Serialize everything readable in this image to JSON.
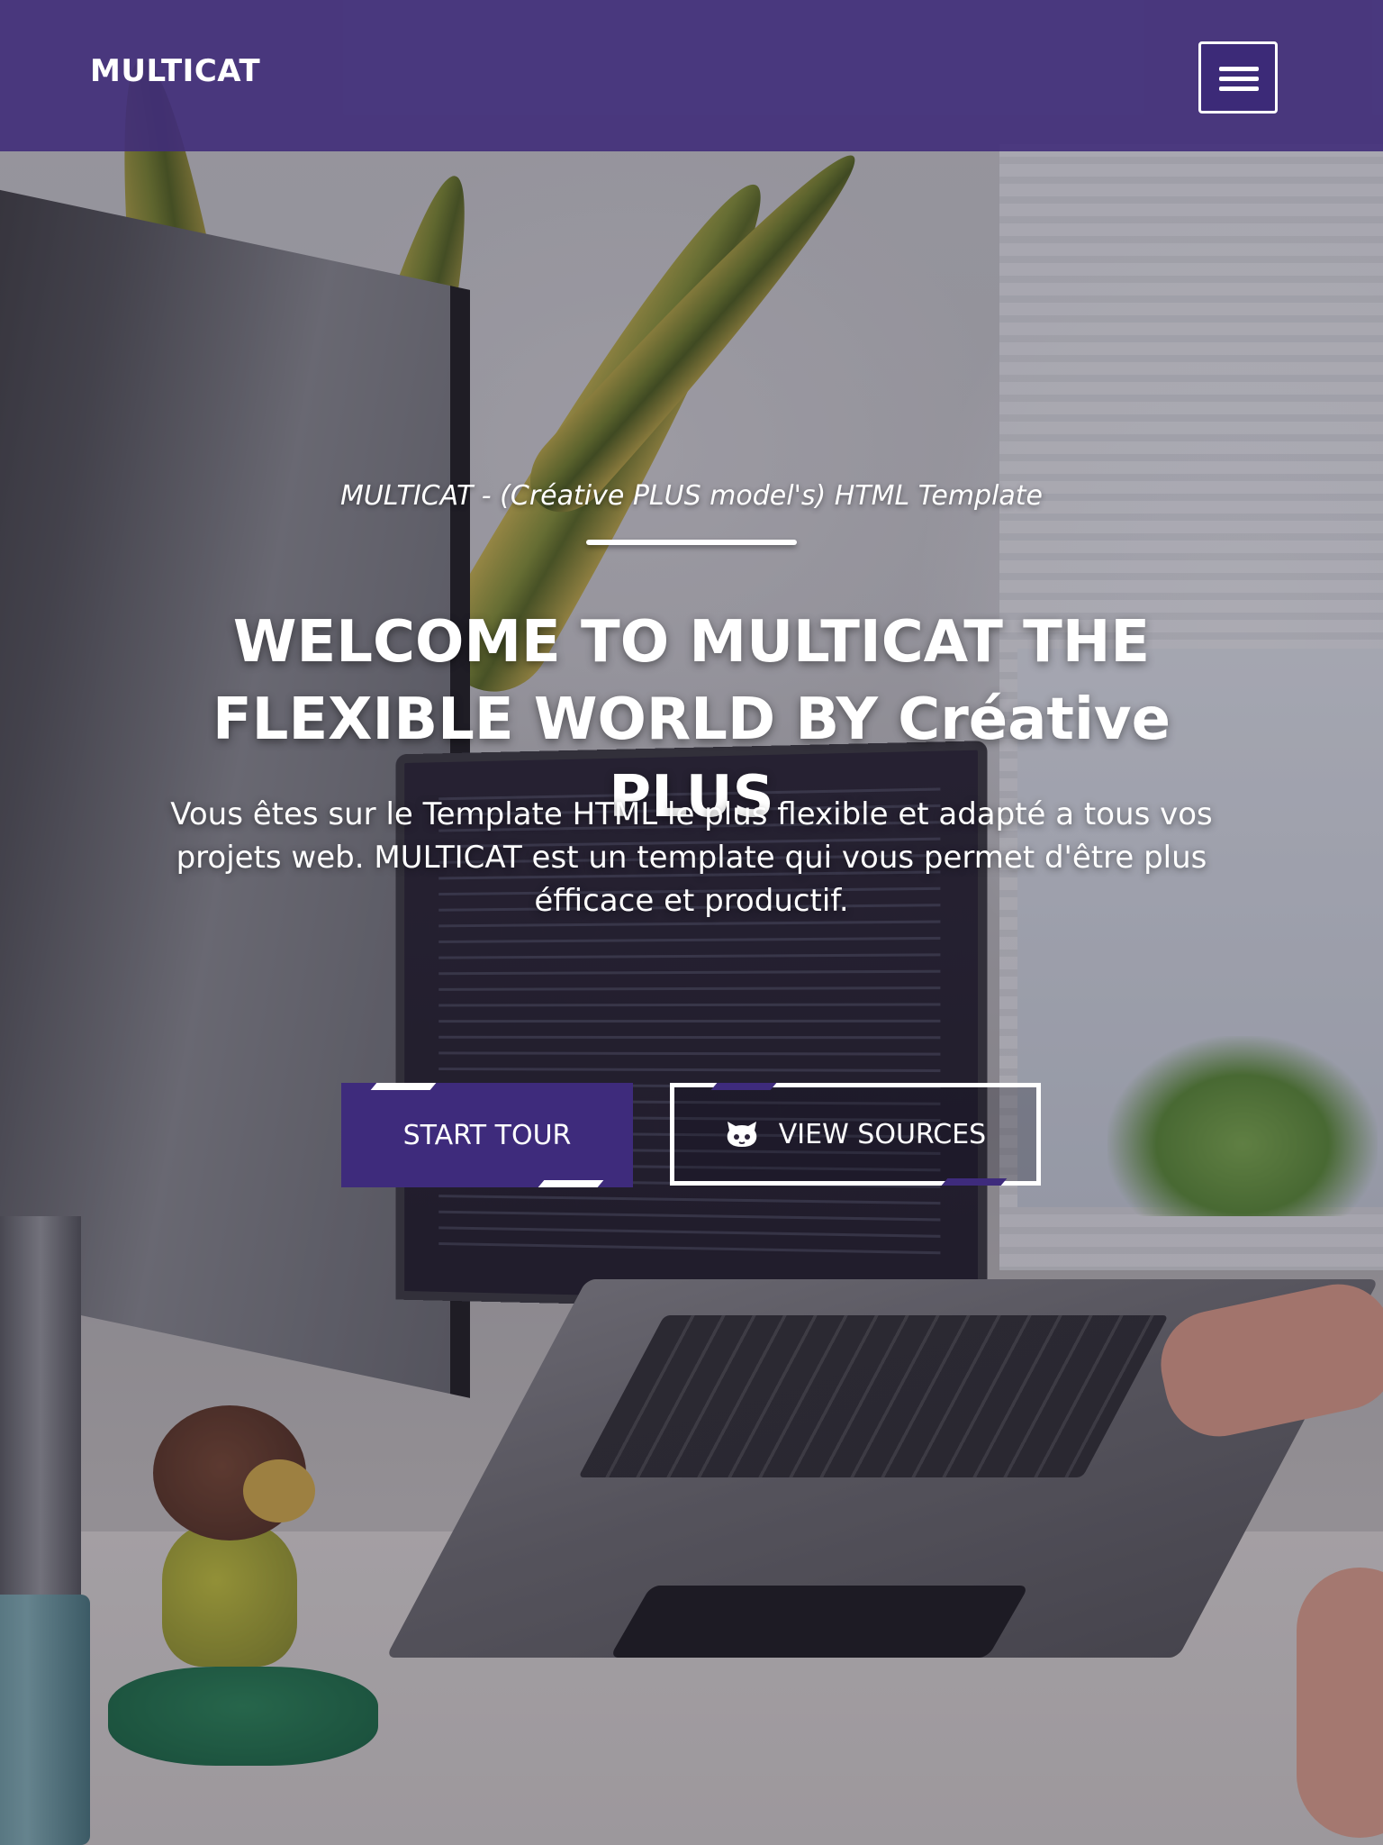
{
  "navbar": {
    "brand": "MULTICAT",
    "menu_toggle_icon": "hamburger-menu-icon"
  },
  "hero": {
    "subtitle": "MULTICAT - (Créative PLUS model's) HTML Template",
    "headline_line1": "WELCOME TO MULTICAT THE",
    "headline_line2": "FLEXIBLE WORLD BY Créative PLUS",
    "lead": "Vous êtes sur le Template HTML le plus flexible et adapté a tous vos projets web. MULTICAT est un template qui vous permet d'être plus éfficace et productif.",
    "buttons": {
      "start_tour": "START TOUR",
      "view_sources": "VIEW SOURCES",
      "view_sources_icon": "github-icon"
    }
  },
  "colors": {
    "brand_purple": "#3e2b7c",
    "navbar_bg": "#402e7a",
    "text": "#ffffff"
  }
}
